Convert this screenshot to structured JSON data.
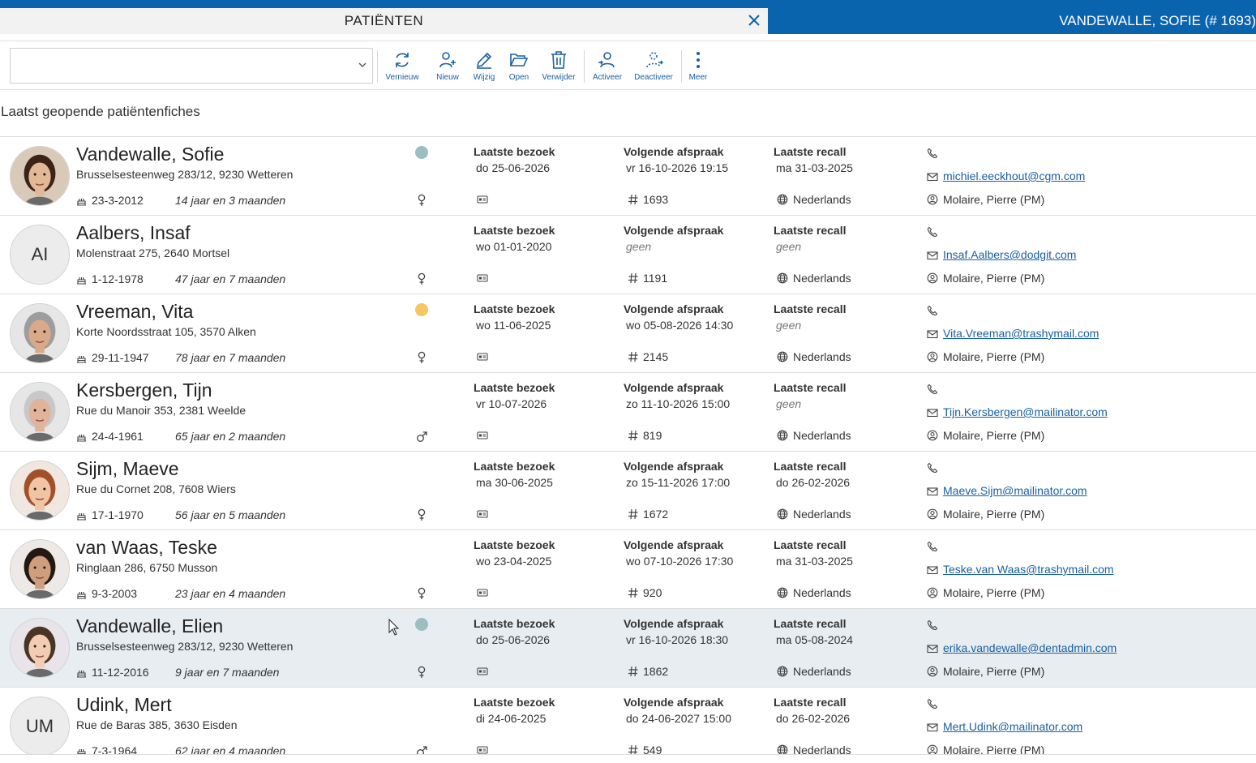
{
  "tabs": {
    "patients_label": "PATIËNTEN",
    "active_label": "VANDEWALLE, SOFIE (# 1693)"
  },
  "toolbar": {
    "search_value": "",
    "buttons": [
      {
        "label": "Vernieuw",
        "icon": "refresh-icon"
      },
      {
        "label": "Nieuw",
        "icon": "add-person-icon"
      },
      {
        "label": "Wijzig",
        "icon": "pencil-icon"
      },
      {
        "label": "Open",
        "icon": "folder-open-icon"
      },
      {
        "label": "Verwijder",
        "icon": "trash-icon"
      },
      {
        "label": "Activeer",
        "icon": "activate-person-icon"
      },
      {
        "label": "Deactiveer",
        "icon": "deactivate-person-icon"
      },
      {
        "label": "Meer",
        "icon": "more-icon"
      }
    ]
  },
  "section_title": "Laatst geopende patiëntenfiches",
  "labels": {
    "last_visit": "Laatste bezoek",
    "next_appointment": "Volgende afspraak",
    "last_recall": "Laatste recall"
  },
  "colors": {
    "brand": "#0a64ad",
    "dot_teal": "#9bbfc0",
    "dot_yellow": "#f7c660",
    "selected_row": "#e8edf2"
  },
  "patients": [
    {
      "name": "Vandewalle, Sofie",
      "address": "Brusselsesteenweg 283/12, 9230 Wetteren",
      "dob": "23-3-2012",
      "age": "14 jaar en 3 maanden",
      "gender": "female",
      "dot": "teal",
      "avatar": "photo",
      "initials": "",
      "last_visit": "do 25-06-2026",
      "next_appointment": "vr 16-10-2026 19:15",
      "last_recall": "ma 31-03-2025",
      "number": "1693",
      "language": "Nederlands",
      "email": "michiel.eeckhout@cgm.com",
      "dentist": "Molaire, Pierre (PM)"
    },
    {
      "name": "Aalbers, Insaf",
      "address": "Molenstraat 275, 2640 Mortsel",
      "dob": "1-12-1978",
      "age": "47 jaar en 7 maanden",
      "gender": "female",
      "dot": "",
      "avatar": "initials",
      "initials": "AI",
      "last_visit": "wo 01-01-2020",
      "next_appointment": "geen",
      "last_recall": "geen",
      "number": "1191",
      "language": "Nederlands",
      "email": "Insaf.Aalbers@dodgit.com",
      "dentist": "Molaire, Pierre (PM)"
    },
    {
      "name": "Vreeman, Vita",
      "address": "Korte Noordsstraat 105, 3570 Alken",
      "dob": "29-11-1947",
      "age": "78 jaar en 7 maanden",
      "gender": "female",
      "dot": "yellow",
      "avatar": "photo",
      "initials": "",
      "last_visit": "wo 11-06-2025",
      "next_appointment": "wo 05-08-2026 14:30",
      "last_recall": "geen",
      "number": "2145",
      "language": "Nederlands",
      "email": "Vita.Vreeman@trashymail.com",
      "dentist": "Molaire, Pierre (PM)"
    },
    {
      "name": "Kersbergen, Tijn",
      "address": "Rue du Manoir 353, 2381 Weelde",
      "dob": "24-4-1961",
      "age": "65 jaar en 2 maanden",
      "gender": "male",
      "dot": "",
      "avatar": "photo",
      "initials": "",
      "last_visit": "vr 10-07-2026",
      "next_appointment": "zo 11-10-2026 15:00",
      "last_recall": "geen",
      "number": "819",
      "language": "Nederlands",
      "email": "Tijn.Kersbergen@mailinator.com",
      "dentist": "Molaire, Pierre (PM)"
    },
    {
      "name": "Sijm, Maeve",
      "address": "Rue du Cornet 208, 7608 Wiers",
      "dob": "17-1-1970",
      "age": "56 jaar en 5 maanden",
      "gender": "female",
      "dot": "",
      "avatar": "photo",
      "initials": "",
      "last_visit": "ma 30-06-2025",
      "next_appointment": "zo 15-11-2026 17:00",
      "last_recall": "do 26-02-2026",
      "number": "1672",
      "language": "Nederlands",
      "email": "Maeve.Sijm@mailinator.com",
      "dentist": "Molaire, Pierre (PM)"
    },
    {
      "name": "van Waas, Teske",
      "address": "Ringlaan 286, 6750 Musson",
      "dob": "9-3-2003",
      "age": "23 jaar en 4 maanden",
      "gender": "female",
      "dot": "",
      "avatar": "photo",
      "initials": "",
      "last_visit": "wo 23-04-2025",
      "next_appointment": "wo 07-10-2026 17:30",
      "last_recall": "ma 31-03-2025",
      "number": "920",
      "language": "Nederlands",
      "email": "Teske.van Waas@trashymail.com",
      "dentist": "Molaire, Pierre (PM)"
    },
    {
      "name": "Vandewalle, Elien",
      "address": "Brusselsesteenweg 283/12, 9230 Wetteren",
      "dob": "11-12-2016",
      "age": "9 jaar en 7 maanden",
      "gender": "female",
      "dot": "teal",
      "avatar": "photo",
      "initials": "",
      "last_visit": "do 25-06-2026",
      "next_appointment": "vr 16-10-2026 18:30",
      "last_recall": "ma 05-08-2024",
      "number": "1862",
      "language": "Nederlands",
      "email": "erika.vandewalle@dentadmin.com",
      "dentist": "Molaire, Pierre (PM)",
      "selected": true
    },
    {
      "name": "Udink, Mert",
      "address": "Rue de Baras 385, 3630 Eisden",
      "dob": "7-3-1964",
      "age": "62 jaar en 4 maanden",
      "gender": "male",
      "dot": "",
      "avatar": "initials",
      "initials": "UM",
      "last_visit": "di 24-06-2025",
      "next_appointment": "do 24-06-2027 15:00",
      "last_recall": "do 26-02-2026",
      "number": "549",
      "language": "Nederlands",
      "email": "Mert.Udink@mailinator.com",
      "dentist": "Molaire, Pierre (PM)"
    }
  ]
}
